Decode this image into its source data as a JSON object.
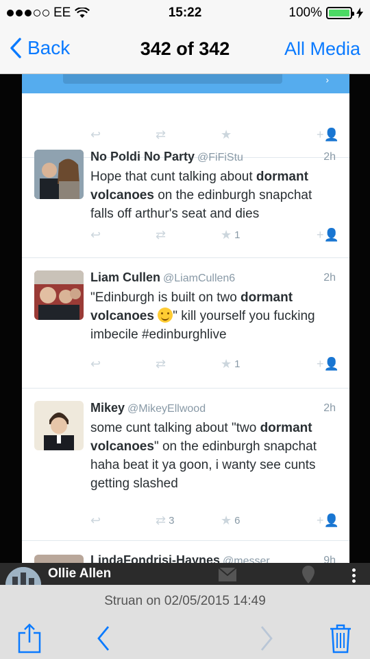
{
  "status_bar": {
    "carrier": "EE",
    "time": "15:22",
    "battery": "100%",
    "battery_level": 1.0
  },
  "nav": {
    "back_label": "Back",
    "title": "342 of 342",
    "all_media_label": "All Media"
  },
  "tweets": [
    {
      "name": "No Poldi No Party",
      "handle": "@FiFiStu",
      "time": "2h",
      "text_parts": [
        "Hope that cunt talking about ",
        "dormant volcanoes",
        " on the edinburgh snapchat falls off arthur's seat and dies"
      ],
      "favorites": "1"
    },
    {
      "name": "Liam Cullen",
      "handle": "@LiamCullen6",
      "time": "2h",
      "text_parts": [
        "\"Edinburgh is built on two ",
        "dormant volcanoes",
        "\" kill yourself you fucking imbecile #edinburghlive"
      ],
      "favorites": "1"
    },
    {
      "name": "Mikey",
      "handle": "@MikeyEllwood",
      "time": "2h",
      "text_parts": [
        "some cunt talking about \"two ",
        "dormant volcanoes",
        "\" on the edinburgh snapchat haha beat it ya goon, i wanty see cunts getting slashed"
      ],
      "retweets": "3",
      "favorites": "6"
    },
    {
      "name": "LindaFondrisi-Haynes",
      "handle": "@messer",
      "time": "9h"
    }
  ],
  "overlay": {
    "name": "Ollie Allen"
  },
  "caption": "Struan on 02/05/2015 14:49",
  "colors": {
    "ios_blue": "#0a7aff",
    "twitter_blue": "#55acee",
    "battery_green": "#4cd964"
  }
}
